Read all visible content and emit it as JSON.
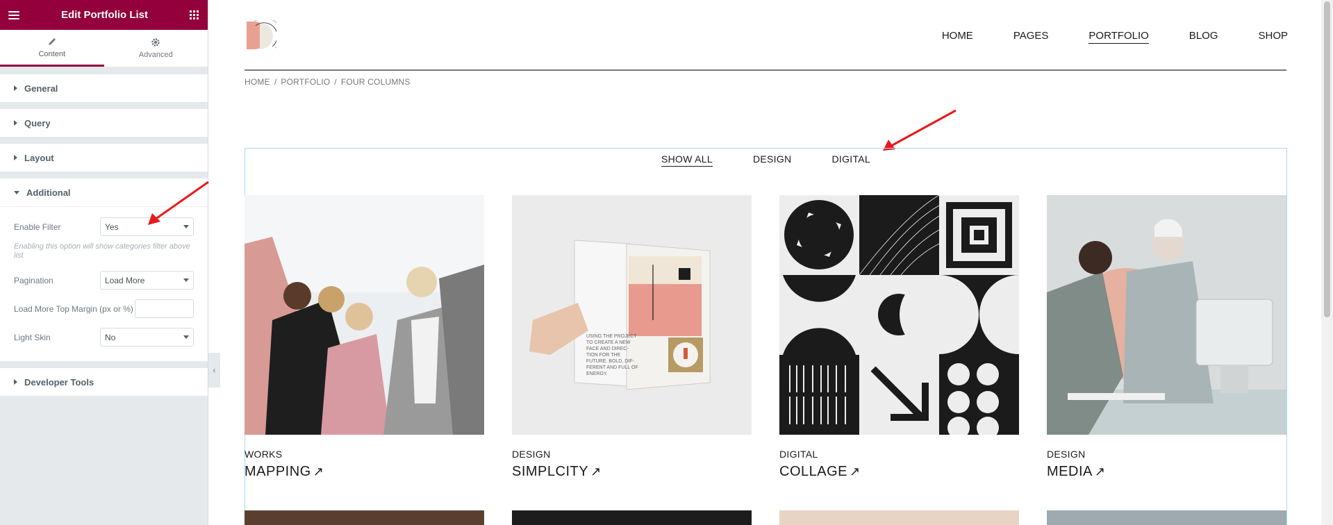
{
  "panel": {
    "title": "Edit Portfolio List",
    "tabs": [
      {
        "label": "Content",
        "icon": "pencil-icon"
      },
      {
        "label": "Advanced",
        "icon": "gear-icon"
      }
    ],
    "sections": {
      "general": "General",
      "query": "Query",
      "layout": "Layout",
      "additional": "Additional",
      "developer_tools": "Developer Tools"
    },
    "additional": {
      "enable_filter_label": "Enable Filter",
      "enable_filter_value": "Yes",
      "enable_filter_desc": "Enabling this option will show categories filter above list",
      "pagination_label": "Pagination",
      "pagination_value": "Load More",
      "load_more_margin_label": "Load More Top Margin (px or %)",
      "load_more_margin_value": "",
      "light_skin_label": "Light Skin",
      "light_skin_value": "No"
    },
    "colors": {
      "accent": "#93003c"
    }
  },
  "site": {
    "nav": [
      "HOME",
      "PAGES",
      "PORTFOLIO",
      "BLOG",
      "SHOP"
    ],
    "breadcrumb": [
      "HOME",
      "PORTFOLIO",
      "FOUR COLUMNS"
    ],
    "filters": [
      "SHOW ALL",
      "DESIGN",
      "DIGITAL"
    ],
    "cards": [
      {
        "category": "WORKS",
        "title": "MAPPING"
      },
      {
        "category": "DESIGN",
        "title": "SIMPLCITY"
      },
      {
        "category": "DIGITAL",
        "title": "COLLAGE"
      },
      {
        "category": "DESIGN",
        "title": "MEDIA"
      }
    ],
    "book_text": "USING THE PROJECT TO CREATE A NEW FACE AND DIRECTION FOR THE FUTURE, BOLD, DIFFERENT AND FULL OF ENERGY."
  }
}
